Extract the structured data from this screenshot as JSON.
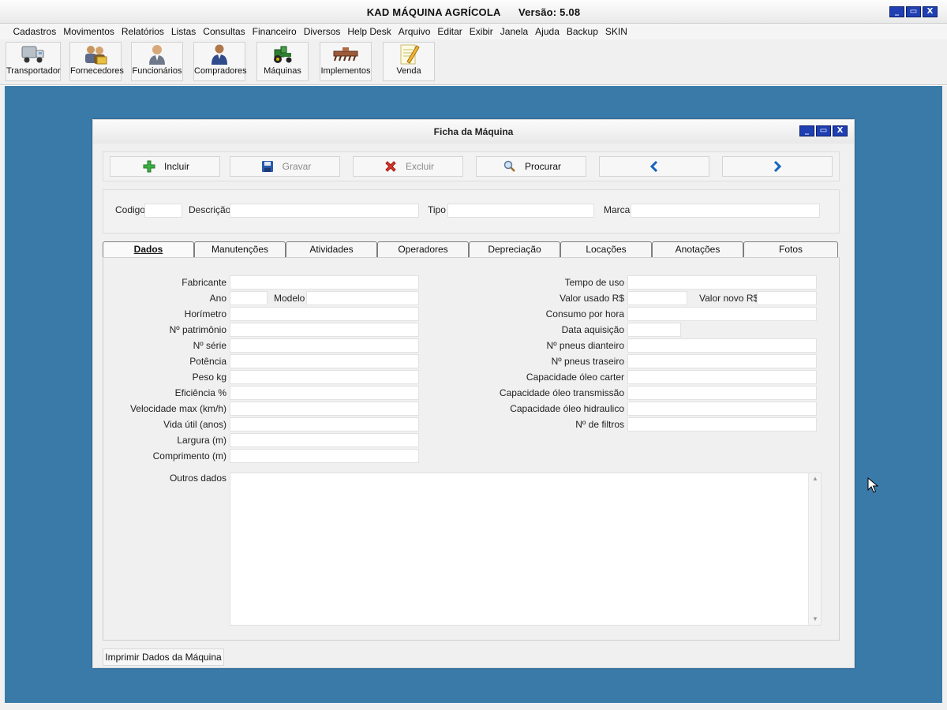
{
  "app": {
    "title": "KAD MÁQUINA AGRÍCOLA      Versão: 5.08",
    "window_buttons": {
      "minimize": "_",
      "maximize": "▭",
      "close": "X"
    }
  },
  "menu": [
    "Cadastros",
    "Movimentos",
    "Relatórios",
    "Listas",
    "Consultas",
    "Financeiro",
    "Diversos",
    "Help Desk",
    "Arquivo",
    "Editar",
    "Exibir",
    "Janela",
    "Ajuda",
    "Backup",
    "SKIN"
  ],
  "toolbar": [
    {
      "label": "Transportador",
      "icon": "truck-icon"
    },
    {
      "label": "Fornecedores",
      "icon": "suppliers-icon"
    },
    {
      "label": "Funcionários",
      "icon": "employee-icon"
    },
    {
      "label": "Compradores",
      "icon": "buyer-icon"
    },
    {
      "label": "Máquinas",
      "icon": "tractor-icon"
    },
    {
      "label": "Implementos",
      "icon": "implement-icon"
    },
    {
      "label": "Venda",
      "icon": "pencil-note-icon"
    }
  ],
  "child_window": {
    "title": "Ficha da Máquina",
    "actions": {
      "incluir": "Incluir",
      "gravar": "Gravar",
      "excluir": "Excluir",
      "procurar": "Procurar",
      "prev": "‹",
      "next": "›"
    },
    "header": {
      "codigo_label": "Codigo",
      "descricao_label": "Descrição",
      "tipo_label": "Tipo",
      "marca_label": "Marca"
    },
    "tabs": [
      "Dados",
      "Manutenções",
      "Atividades",
      "Operadores",
      "Depreciação",
      "Locações",
      "Anotações",
      "Fotos"
    ],
    "active_tab": "Dados",
    "left_fields": [
      "Fabricante",
      "Ano",
      "Horímetro",
      "Nº patrimônio",
      "Nº série",
      "Potência",
      "Peso kg",
      "Eficiência %",
      "Velocidade max (km/h)",
      "Vida útil (anos)",
      "Largura (m)",
      "Comprimento (m)"
    ],
    "modelo_label": "Modelo",
    "right_fields": [
      "Tempo de uso",
      "Valor usado R$",
      "Consumo por hora",
      "Data aquisição",
      "Nº pneus dianteiro",
      "Nº pneus traseiro",
      "Capacidade óleo carter",
      "Capacidade óleo transmissão",
      "Capacidade óleo hidraulico",
      "Nº de filtros"
    ],
    "valor_novo_label": "Valor novo R$",
    "outros_label": "Outros dados",
    "print_button": "Imprimir Dados da Máquina"
  }
}
